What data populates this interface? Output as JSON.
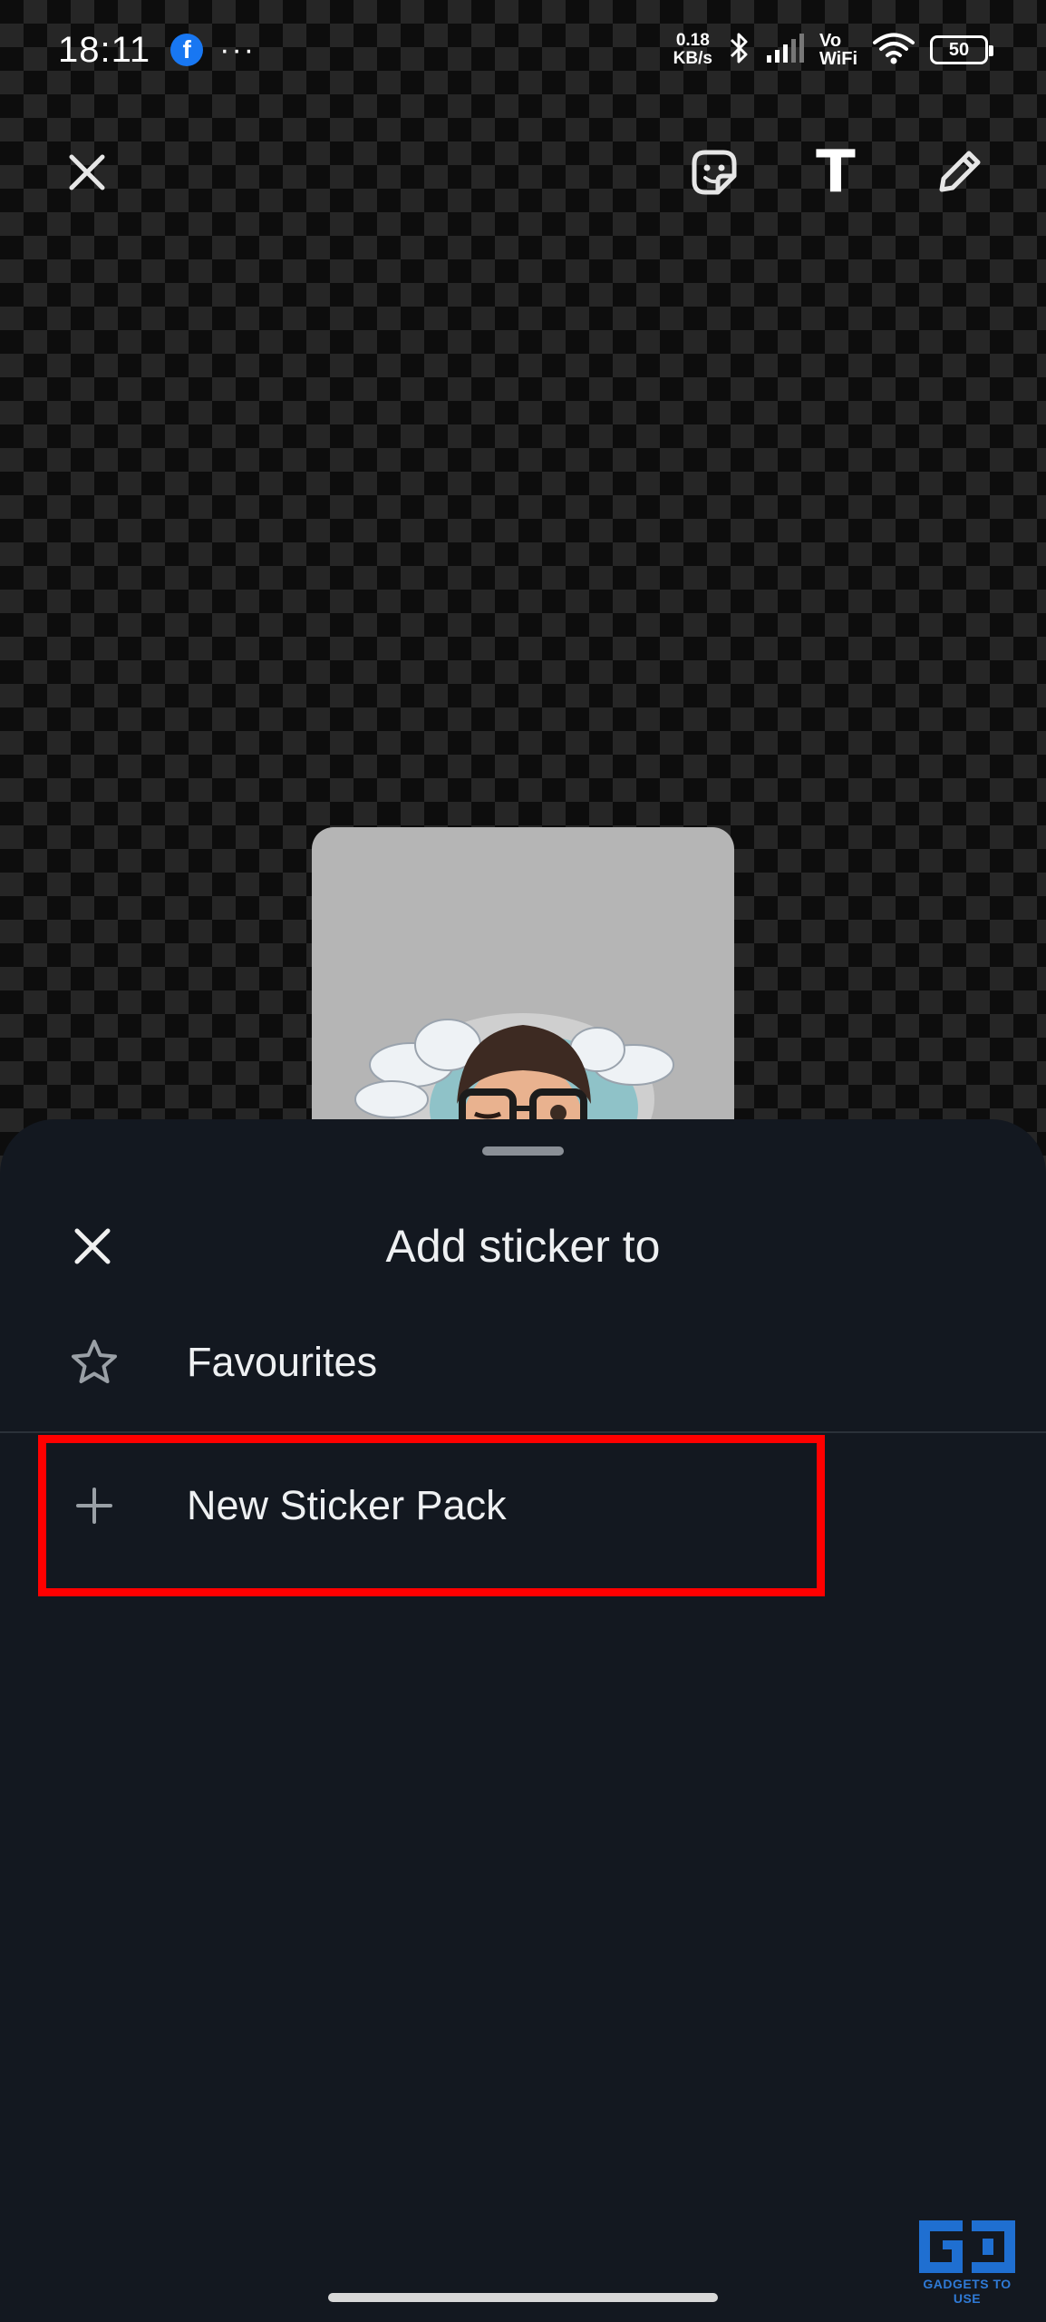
{
  "status_bar": {
    "time": "18:11",
    "facebook_badge": "f",
    "more_indicator": "···",
    "net_speed_value": "0.18",
    "net_speed_unit": "KB/s",
    "vowifi_top": "Vo",
    "vowifi_bottom": "WiFi",
    "battery": "50"
  },
  "editor_toolbar": {
    "close_icon": "close-icon",
    "sticker_icon": "sticker-icon",
    "text_tool_label": "T",
    "pencil_icon": "pencil-icon"
  },
  "sheet": {
    "title": "Add sticker to",
    "options": [
      {
        "label": "Favourites",
        "icon": "star-outline-icon"
      },
      {
        "label": "New Sticker Pack",
        "icon": "plus-icon"
      }
    ],
    "highlight_color": "#ff0000"
  },
  "watermark": {
    "text": "GADGETS TO USE"
  },
  "colors": {
    "sheet_background": "#131820",
    "facebook_blue": "#1877f2",
    "highlight": "#ff0000"
  }
}
